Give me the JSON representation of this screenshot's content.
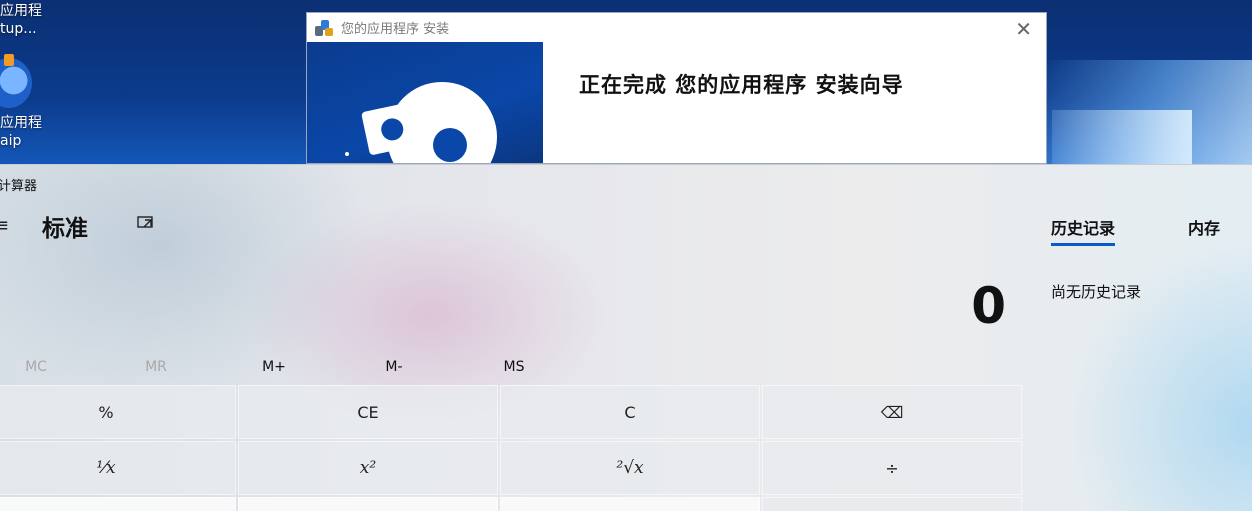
{
  "desktop": {
    "icons": [
      {
        "label_line1": "应用程",
        "label_line2": "tup..."
      },
      {
        "label_line1": "应用程",
        "label_line2": "aip"
      }
    ]
  },
  "installer": {
    "title": "您的应用程序 安装",
    "heading": "正在完成 您的应用程序 安装向导",
    "close_label": "✕"
  },
  "calculator": {
    "app_title": "计算器",
    "mode": "标准",
    "display_value": "0",
    "memory": {
      "mc": "MC",
      "mr": "MR",
      "mplus": "M+",
      "mminus": "M-",
      "ms": "MS"
    },
    "row1": [
      "%",
      "CE",
      "C",
      "⌫"
    ],
    "row2": [
      "¹⁄x",
      "x²",
      "²√x",
      "÷"
    ],
    "tabs": {
      "history": "历史记录",
      "memory": "内存"
    },
    "history_empty": "尚无历史记录",
    "accent_color": "#0a5cc2"
  }
}
